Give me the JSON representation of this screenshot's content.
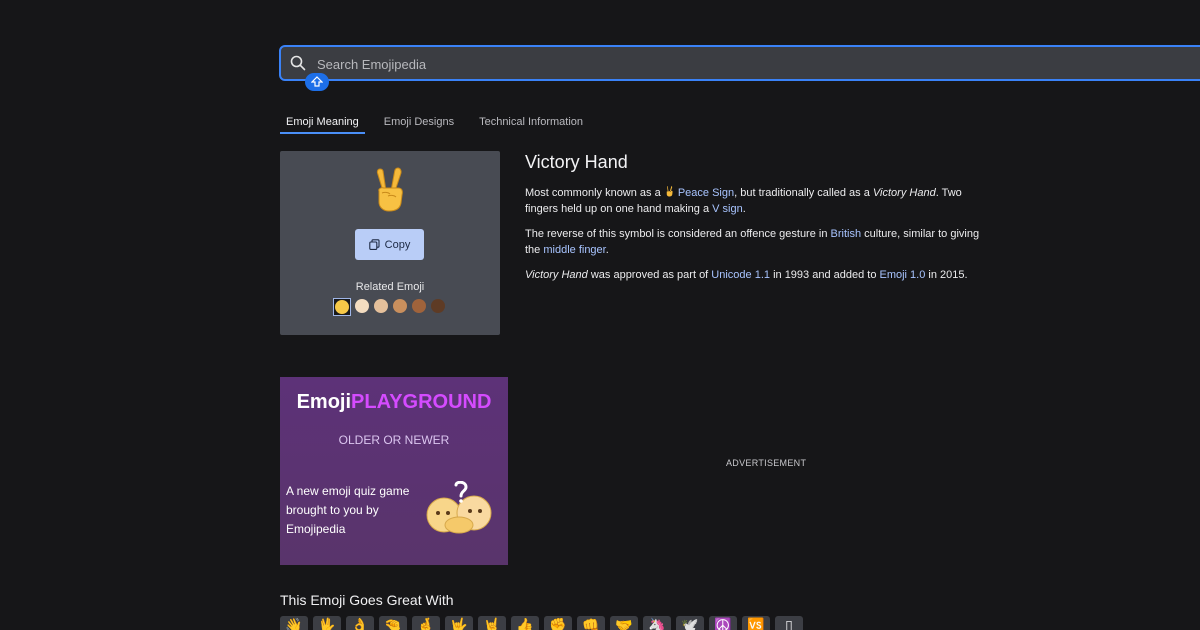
{
  "search": {
    "placeholder": "Search Emojipedia"
  },
  "tabs": [
    {
      "label": "Emoji Meaning",
      "active": true
    },
    {
      "label": "Emoji Designs",
      "active": false
    },
    {
      "label": "Technical Information",
      "active": false
    }
  ],
  "emoji_card": {
    "emoji": "✌️",
    "copy_label": "Copy",
    "related_label": "Related Emoji",
    "skin_tones": [
      "#f7c948",
      "#f3dcc0",
      "#e5c09b",
      "#c98f5d",
      "#a0633b",
      "#5e3b25"
    ]
  },
  "meaning": {
    "title": "Victory Hand",
    "p1": {
      "t1": "Most commonly known as a ",
      "link1": "Peace Sign",
      "t2": ", but traditionally called as a ",
      "em1": "Victory Hand",
      "t3": ". Two fingers held up on one hand making a ",
      "link2": "V sign",
      "t4": "."
    },
    "p2": {
      "t1": "The reverse of this symbol is considered an offence gesture in ",
      "link1": "British",
      "t2": " culture, similar to giving the ",
      "link2": "middle finger",
      "t3": "."
    },
    "p3": {
      "em1": "Victory Hand",
      "t1": " was approved as part of ",
      "link1": "Unicode 1.1",
      "t2": " in 1993 and added to ",
      "link2": "Emoji 1.0",
      "t3": " in 2015."
    }
  },
  "playground": {
    "title_white": "Emoji",
    "title_purple": "PLAYGROUND",
    "subtitle": "OLDER OR NEWER",
    "text": "A new emoji quiz game brought to you by Emojipedia"
  },
  "ad_label": "ADVERTISEMENT",
  "goes_great": {
    "title": "This Emoji Goes Great With",
    "items": [
      "👋",
      "🖖",
      "👌",
      "🤏",
      "🤞",
      "🤟",
      "🤘",
      "👍",
      "✊",
      "👊",
      "🤝",
      "🦄",
      "🕊️",
      "☮️",
      "🆚",
      "▯"
    ]
  }
}
